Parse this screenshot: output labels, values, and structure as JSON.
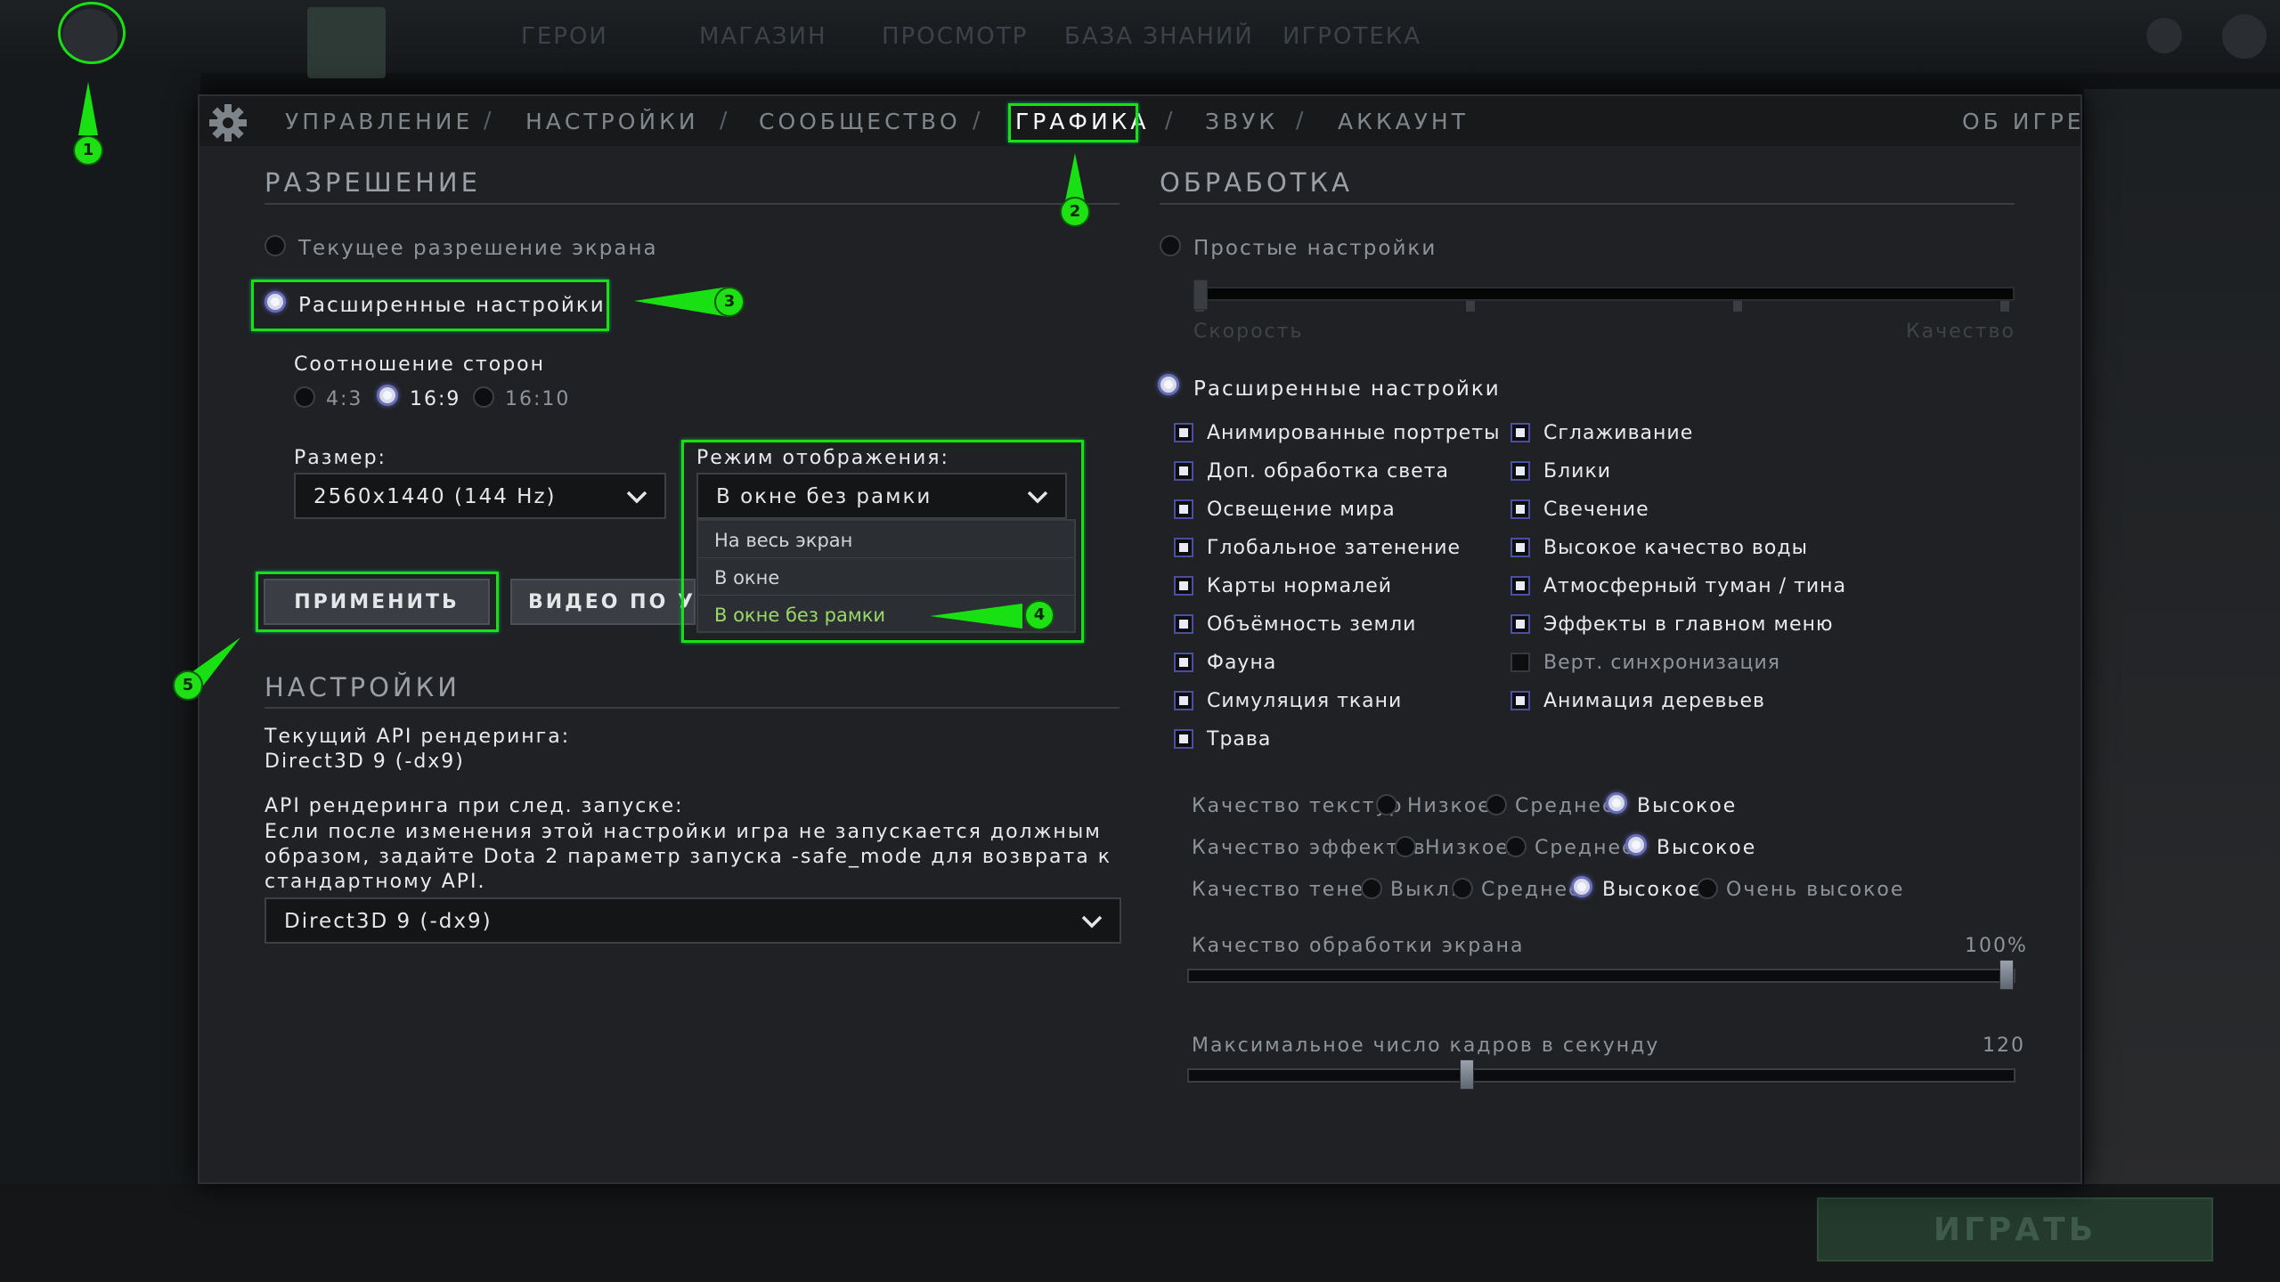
{
  "client": {
    "top_nav": [
      "ГЕРОИ",
      "МАГАЗИН",
      "ПРОСМОТР",
      "БАЗА ЗНАНИЙ",
      "ИГРОТЕКА"
    ],
    "play_label": "ИГРАТЬ"
  },
  "tabs": {
    "control": "УПРАВЛЕНИЕ",
    "settings": "НАСТРОЙКИ",
    "community": "СООБЩЕСТВО",
    "graphics": "ГРАФИКА",
    "sound": "ЗВУК",
    "account": "АККАУНТ",
    "about": "ОБ ИГРЕ",
    "separator": "/"
  },
  "resolution": {
    "title": "РАЗРЕШЕНИЕ",
    "current_label": "Текущее разрешение экрана",
    "advanced_label": "Расширенные настройки",
    "aspect_label": "Соотношение сторон",
    "aspect_options": [
      "4:3",
      "16:9",
      "16:10"
    ],
    "size_label": "Размер:",
    "size_value": "2560x1440 (144 Hz)",
    "mode_label": "Режим отображения:",
    "mode_value": "В окне без рамки",
    "mode_options": [
      "На весь экран",
      "В окне",
      "В окне без рамки"
    ],
    "apply_label": "ПРИМЕНИТЬ",
    "default_video_label": "ВИДЕО ПО УМО"
  },
  "settings": {
    "title": "НАСТРОЙКИ",
    "api_current_label": "Текущий API рендеринга:",
    "api_current_value": "Direct3D 9 (-dx9)",
    "api_next_label": "API рендеринга при след. запуске:",
    "api_note_1": "Если после изменения этой настройки игра не запускается должным",
    "api_note_2": "образом, задайте Dota 2 параметр запуска -safe_mode для возврата к",
    "api_note_3": "стандартному API.",
    "api_select_value": "Direct3D 9 (-dx9)"
  },
  "processing": {
    "title": "ОБРАБОТКА",
    "simple_label": "Простые настройки",
    "speed_label": "Скорость",
    "quality_label": "Качество",
    "advanced_label": "Расширенные настройки",
    "checks_left": [
      "Анимированные портреты",
      "Доп. обработка света",
      "Освещение мира",
      "Глобальное затенение",
      "Карты нормалей",
      "Объёмность земли",
      "Фауна",
      "Симуляция ткани",
      "Трава"
    ],
    "checks_right": [
      "Сглаживание",
      "Блики",
      "Свечение",
      "Высокое качество воды",
      "Атмосферный туман / тина",
      "Эффекты в главном меню",
      "Верт. синхронизация",
      "Анимация деревьев"
    ],
    "texture_label": "Качество текстур",
    "texture_opts": [
      "Низкое",
      "Среднее",
      "Высокое"
    ],
    "effects_label": "Качество эффектов",
    "effects_opts": [
      "Низкое",
      "Среднее",
      "Высокое"
    ],
    "shadow_label": "Качество теней",
    "shadow_opts": [
      "Выкл.",
      "Среднее",
      "Высокое",
      "Очень высокое"
    ],
    "screen_quality_label": "Качество обработки экрана",
    "screen_quality_value": "100%",
    "screen_quality_level": 1.0,
    "fps_label": "Максимальное число кадров в секунду",
    "fps_value": "120",
    "fps_level": 0.335
  },
  "annotations": [
    "1",
    "2",
    "3",
    "4",
    "5"
  ],
  "colors": {
    "accent_green": "#18e012",
    "selected_radio": "#6a6fb8"
  }
}
